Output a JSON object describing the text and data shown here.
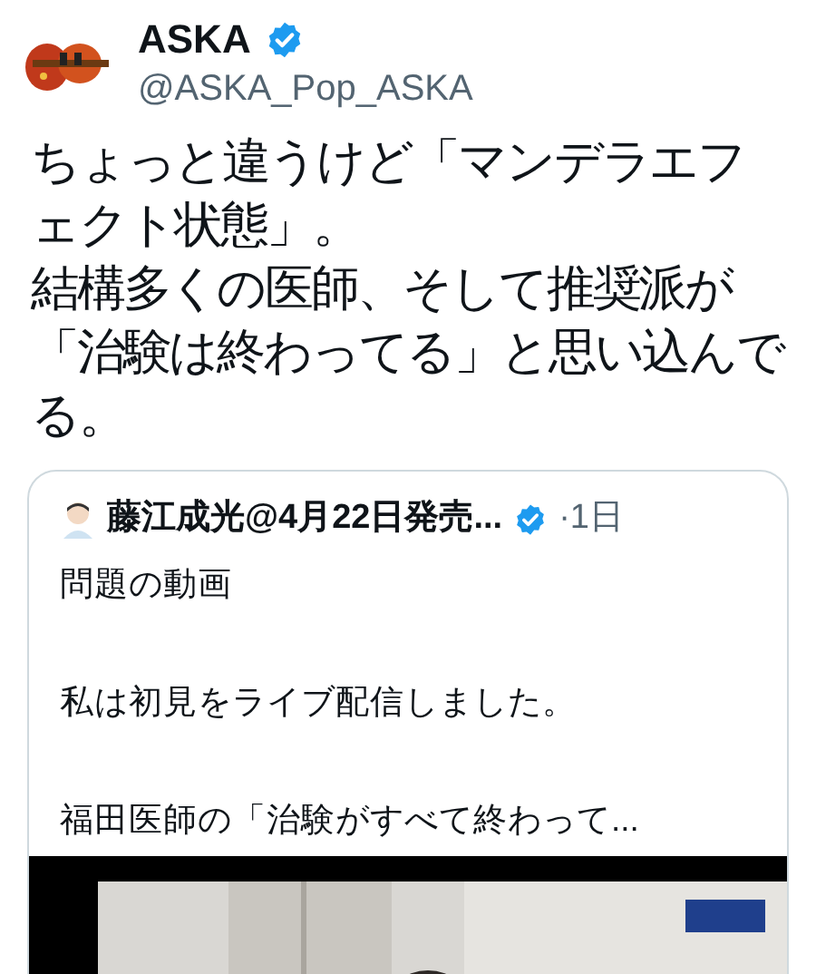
{
  "author": {
    "name": "ASKA",
    "verified": true,
    "handle": "@ASKA_Pop_ASKA"
  },
  "text": [
    "ちょっと違うけど「マンデラエフェクト状態」。",
    "結構多くの医師、そして推奨派が「治験は終わってる」と思い込んでる。"
  ],
  "quote": {
    "name": "藤江成光@4月22日発売...",
    "verified": true,
    "time": "·1日",
    "paragraphs": [
      "問題の動画",
      "私は初見をライブ配信しました。",
      "福田医師の「治験がすべて終わって..."
    ]
  }
}
